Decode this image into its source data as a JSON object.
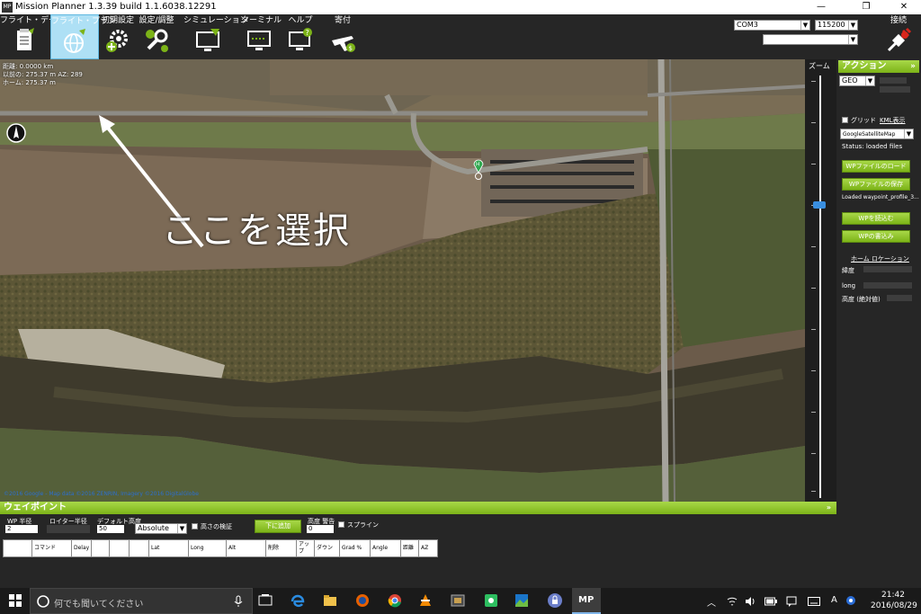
{
  "window": {
    "title": "Mission Planner 1.3.39 build 1.1.6038.12291",
    "app_icon_text": "MP",
    "controls": {
      "minimize": "—",
      "restore": "❐",
      "close": "✕"
    }
  },
  "toolbar": {
    "items": [
      {
        "label": "フライト・データ",
        "icon": "clipboard-icon"
      },
      {
        "label": "フライト・プラン",
        "icon": "globe-icon",
        "selected": true
      },
      {
        "label": "初期設定",
        "icon": "gear-plus-icon"
      },
      {
        "label": "設定/調整",
        "icon": "wrench-icon"
      },
      {
        "label": "シミュレーション",
        "icon": "monitor-plane-icon"
      },
      {
        "label": "ターミナル",
        "icon": "terminal-icon"
      },
      {
        "label": "ヘルプ",
        "icon": "help-monitor-icon"
      },
      {
        "label": "寄付",
        "icon": "plane-dollar-icon"
      }
    ],
    "port": "COM3",
    "baud": "115200",
    "connect_label": "接続"
  },
  "map": {
    "info": {
      "distance": "距離: 0.0000 km",
      "prev": "以前の: 275.37 m AZ: 289",
      "home": "ホーム: 275.37 m"
    },
    "annotation": "ここを選択",
    "marker_label": "H",
    "copyright": "©2016 Google - Map data ©2016 ZENRIN, Imagery ©2016 DigitalGlobe"
  },
  "zoom": {
    "label": "ズーム",
    "level": 0.31
  },
  "action_panel": {
    "title": "アクション",
    "collapse_icon": "»",
    "coord_mode": "GEO",
    "grid_label": "グリッド",
    "kml_label": "KML表示",
    "map_type": "GoogleSatelliteMap",
    "status": "Status: loaded files",
    "load_wp_file": "WPファイルのロード",
    "save_wp_file": "WPファイルの保存",
    "loaded_file": "Loaded waypoint_profile_3...",
    "read_wp": "WPを読込む",
    "write_wp": "WPの書込み",
    "home_location": "ホーム ロケーション",
    "lat_label": "緯度",
    "long_label": "long",
    "alt_label": "高度 (絶対値)"
  },
  "waypoints": {
    "title": "ウェイポイント",
    "collapse_icon": "»",
    "wp_radius_label": "WP 半径",
    "wp_radius_value": "2",
    "loiter_radius_label": "ロイター半径",
    "default_alt_label": "デフォルト高度",
    "default_alt_value": "50",
    "alt_mode": "Absolute",
    "verify_height": "高さの検証",
    "add_below": "下に追加",
    "alt_warning_label": "高度 警告",
    "alt_warning_value": "0",
    "spline": "スプライン",
    "columns": [
      "",
      "コマンド",
      "Delay",
      "",
      "",
      "",
      "Lat",
      "Long",
      "Alt",
      "削除",
      "アップ",
      "ダウン",
      "Grad %",
      "Angle",
      "距離",
      "AZ"
    ]
  },
  "taskbar": {
    "search_placeholder": "何でも聞いてください",
    "time": "21:42",
    "date": "2016/08/29",
    "ime": "A"
  }
}
